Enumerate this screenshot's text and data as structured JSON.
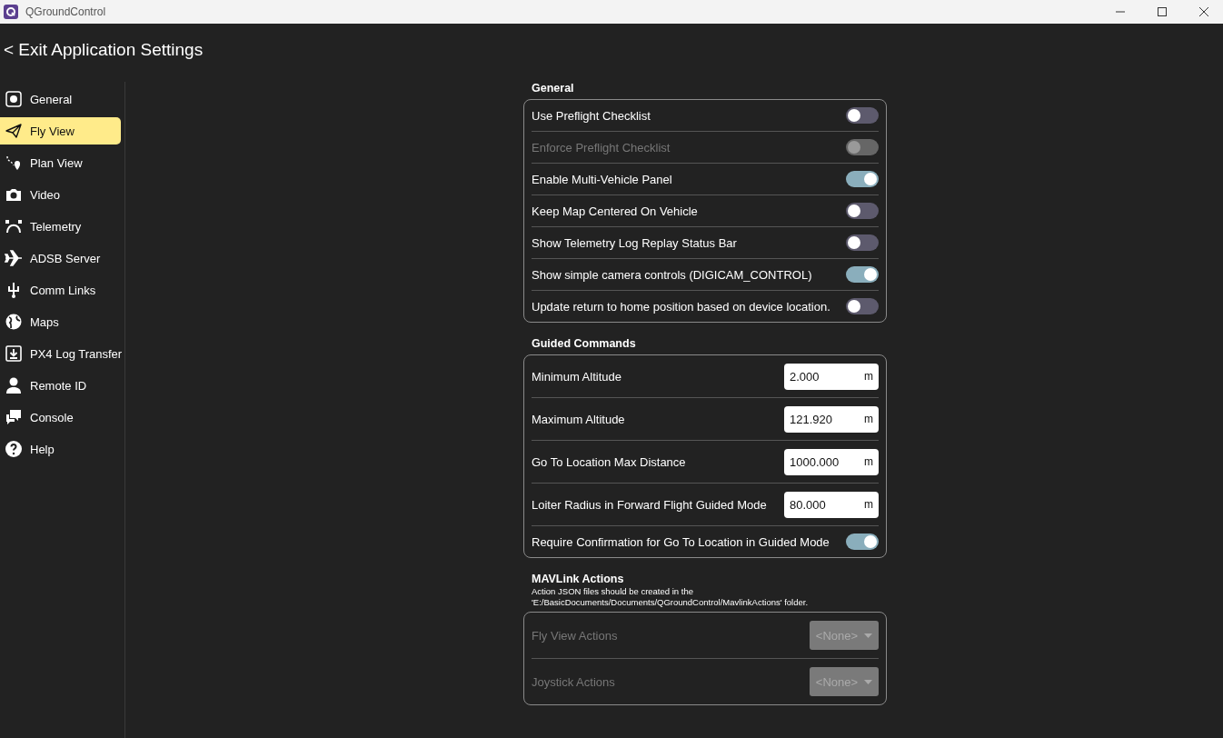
{
  "window": {
    "title": "QGroundControl"
  },
  "header": {
    "back": "<",
    "title": "Exit Application Settings"
  },
  "sidebar": {
    "items": [
      {
        "label": "General",
        "selected": false
      },
      {
        "label": "Fly View",
        "selected": true
      },
      {
        "label": "Plan View",
        "selected": false
      },
      {
        "label": "Video",
        "selected": false
      },
      {
        "label": "Telemetry",
        "selected": false
      },
      {
        "label": "ADSB Server",
        "selected": false
      },
      {
        "label": "Comm Links",
        "selected": false
      },
      {
        "label": "Maps",
        "selected": false
      },
      {
        "label": "PX4 Log Transfer",
        "selected": false
      },
      {
        "label": "Remote ID",
        "selected": false
      },
      {
        "label": "Console",
        "selected": false
      },
      {
        "label": "Help",
        "selected": false
      }
    ]
  },
  "sections": [
    {
      "title": "General",
      "rows": [
        {
          "kind": "toggle",
          "label": "Use Preflight Checklist",
          "on": false,
          "disabled": false
        },
        {
          "kind": "toggle",
          "label": "Enforce Preflight Checklist",
          "on": false,
          "disabled": true
        },
        {
          "kind": "toggle",
          "label": "Enable Multi-Vehicle Panel",
          "on": true,
          "disabled": false
        },
        {
          "kind": "toggle",
          "label": "Keep Map Centered On Vehicle",
          "on": false,
          "disabled": false
        },
        {
          "kind": "toggle",
          "label": "Show Telemetry Log Replay Status Bar",
          "on": false,
          "disabled": false
        },
        {
          "kind": "toggle",
          "label": "Show simple camera controls (DIGICAM_CONTROL)",
          "on": true,
          "disabled": false
        },
        {
          "kind": "toggle",
          "label": "Update return to home position based on device location.",
          "on": false,
          "disabled": false
        }
      ]
    },
    {
      "title": "Guided Commands",
      "rows": [
        {
          "kind": "number",
          "label": "Minimum Altitude",
          "value": "2.000",
          "unit": "m",
          "disabled": false
        },
        {
          "kind": "number",
          "label": "Maximum Altitude",
          "value": "121.920",
          "unit": "m",
          "disabled": false
        },
        {
          "kind": "number",
          "label": "Go To Location Max Distance",
          "value": "1000.000",
          "unit": "m",
          "disabled": false
        },
        {
          "kind": "number",
          "label": "Loiter Radius in Forward Flight Guided Mode",
          "value": "80.000",
          "unit": "m",
          "disabled": false
        },
        {
          "kind": "toggle",
          "label": "Require Confirmation for Go To Location in Guided Mode",
          "on": true,
          "disabled": false
        }
      ]
    },
    {
      "title": "MAVLink Actions",
      "note": "Action JSON files should be created in the 'E:/BasicDocuments/Documents/QGroundControl/MavlinkActions' folder.",
      "rows": [
        {
          "kind": "dropdown",
          "label": "Fly View Actions",
          "value": "<None>",
          "disabled": true
        },
        {
          "kind": "dropdown",
          "label": "Joystick Actions",
          "value": "<None>",
          "disabled": true
        }
      ]
    }
  ]
}
